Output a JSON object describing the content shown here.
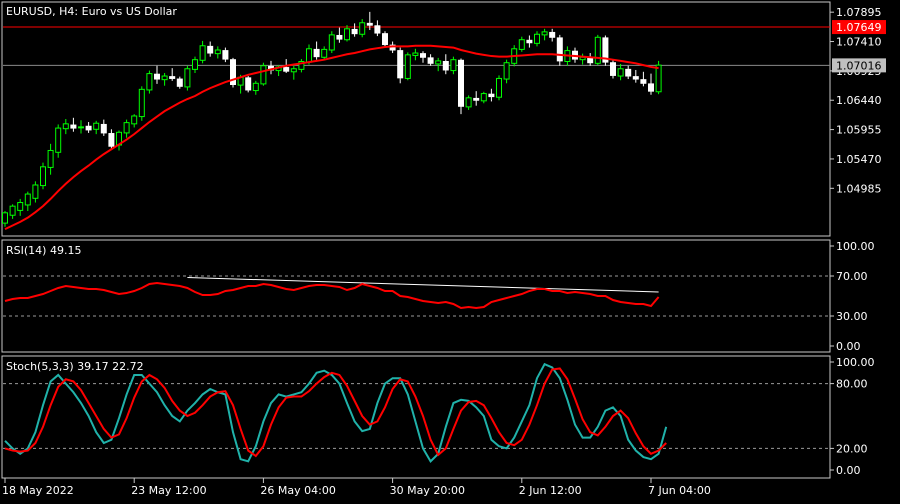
{
  "theme": {
    "background": "#000000",
    "frame": "#c8c8c8",
    "grid_dash": "#9a9a9a",
    "bull_candle": "#00ff00",
    "bear_candle": "#ffffff",
    "ma_line": "#ff0000",
    "rsi_line": "#ff0000",
    "trend_line": "#ffffff",
    "stoch_main": "#20b2aa",
    "stoch_signal": "#ff0000",
    "red_level_tag": "#ff0000",
    "price_tag": "#c0c0c0"
  },
  "chart_data": [
    {
      "type": "candlestick",
      "title": "EURUSD, H4:  Euro vs US Dollar",
      "ylim": [
        1.0423,
        1.0803
      ],
      "y_ticks": [
        "1.07895",
        "1.07410",
        "1.06925",
        "1.06440",
        "1.05955",
        "1.05470",
        "1.04985"
      ],
      "levels": [
        {
          "name": "red-level",
          "value": 1.07649,
          "label": "1.07649"
        },
        {
          "name": "current-price",
          "value": 1.07016,
          "label": "1.07016"
        }
      ],
      "candles": [
        [
          1.0441,
          1.0461,
          1.0435,
          1.0458
        ],
        [
          1.0454,
          1.0472,
          1.0448,
          1.0469
        ],
        [
          1.0462,
          1.0481,
          1.0453,
          1.0475
        ],
        [
          1.0471,
          1.0493,
          1.0461,
          1.0489
        ],
        [
          1.0482,
          1.051,
          1.0475,
          1.0504
        ],
        [
          1.0503,
          1.0541,
          1.0497,
          1.0534
        ],
        [
          1.0533,
          1.0572,
          1.0521,
          1.0561
        ],
        [
          1.0558,
          1.0604,
          1.0549,
          1.0598
        ],
        [
          1.0597,
          1.0613,
          1.0588,
          1.0605
        ],
        [
          1.0603,
          1.0615,
          1.0592,
          1.0598
        ],
        [
          1.0599,
          1.0611,
          1.0589,
          1.06
        ],
        [
          1.0601,
          1.0608,
          1.059,
          1.0595
        ],
        [
          1.0596,
          1.061,
          1.0588,
          1.0606
        ],
        [
          1.0604,
          1.0612,
          1.0585,
          1.059
        ],
        [
          1.0589,
          1.0596,
          1.0563,
          1.0568
        ],
        [
          1.057,
          1.0594,
          1.0561,
          1.0591
        ],
        [
          1.059,
          1.0612,
          1.0582,
          1.0607
        ],
        [
          1.0605,
          1.0621,
          1.0599,
          1.0618
        ],
        [
          1.0617,
          1.0667,
          1.061,
          1.0662
        ],
        [
          1.0661,
          1.0693,
          1.0655,
          1.0688
        ],
        [
          1.0687,
          1.0701,
          1.0671,
          1.0679
        ],
        [
          1.0678,
          1.0689,
          1.0668,
          1.0684
        ],
        [
          1.0683,
          1.0697,
          1.0676,
          1.068
        ],
        [
          1.0679,
          1.0683,
          1.0663,
          1.0667
        ],
        [
          1.0666,
          1.0701,
          1.066,
          1.0696
        ],
        [
          1.0695,
          1.0716,
          1.0689,
          1.0711
        ],
        [
          1.071,
          1.0742,
          1.0705,
          1.0734
        ],
        [
          1.0733,
          1.0741,
          1.0716,
          1.0722
        ],
        [
          1.0721,
          1.0733,
          1.0713,
          1.0727
        ],
        [
          1.0726,
          1.0731,
          1.0707,
          1.0712
        ],
        [
          1.0711,
          1.0714,
          1.0665,
          1.067
        ],
        [
          1.0669,
          1.0686,
          1.0655,
          1.0682
        ],
        [
          1.0681,
          1.0684,
          1.0657,
          1.0661
        ],
        [
          1.066,
          1.0676,
          1.0653,
          1.0672
        ],
        [
          1.0671,
          1.0706,
          1.0668,
          1.0701
        ],
        [
          1.07,
          1.0709,
          1.0687,
          1.0694
        ],
        [
          1.0693,
          1.0702,
          1.0684,
          1.0699
        ],
        [
          1.0698,
          1.0712,
          1.0689,
          1.0692
        ],
        [
          1.0691,
          1.0701,
          1.0678,
          1.0696
        ],
        [
          1.0695,
          1.0712,
          1.069,
          1.0708
        ],
        [
          1.0707,
          1.0736,
          1.0703,
          1.0729
        ],
        [
          1.0728,
          1.0741,
          1.0711,
          1.0716
        ],
        [
          1.0715,
          1.0733,
          1.071,
          1.0728
        ],
        [
          1.0727,
          1.0758,
          1.0722,
          1.0752
        ],
        [
          1.0751,
          1.0764,
          1.0739,
          1.0745
        ],
        [
          1.0744,
          1.0768,
          1.0741,
          1.0762
        ],
        [
          1.0761,
          1.0771,
          1.0749,
          1.0754
        ],
        [
          1.0753,
          1.0778,
          1.0748,
          1.0772
        ],
        [
          1.0771,
          1.079,
          1.076,
          1.0768
        ],
        [
          1.0767,
          1.0776,
          1.075,
          1.0755
        ],
        [
          1.0754,
          1.0758,
          1.0731,
          1.0736
        ],
        [
          1.0735,
          1.0741,
          1.0722,
          1.0727
        ],
        [
          1.0726,
          1.0731,
          1.0672,
          1.0681
        ],
        [
          1.068,
          1.0723,
          1.0677,
          1.0719
        ],
        [
          1.0718,
          1.0729,
          1.071,
          1.0722
        ],
        [
          1.0721,
          1.0725,
          1.0706,
          1.0715
        ],
        [
          1.0714,
          1.072,
          1.0701,
          1.0705
        ],
        [
          1.0704,
          1.0714,
          1.0692,
          1.0709
        ],
        [
          1.0708,
          1.072,
          1.0687,
          1.0694
        ],
        [
          1.0693,
          1.0716,
          1.0687,
          1.0711
        ],
        [
          1.071,
          1.0713,
          1.0621,
          1.0634
        ],
        [
          1.0633,
          1.0652,
          1.0628,
          1.0648
        ],
        [
          1.0647,
          1.0659,
          1.0635,
          1.0644
        ],
        [
          1.0643,
          1.0658,
          1.0639,
          1.0655
        ],
        [
          1.0654,
          1.0663,
          1.0642,
          1.065
        ],
        [
          1.0649,
          1.0685,
          1.0644,
          1.068
        ],
        [
          1.0679,
          1.0711,
          1.0672,
          1.0706
        ],
        [
          1.0705,
          1.0735,
          1.07,
          1.0729
        ],
        [
          1.0728,
          1.0749,
          1.0724,
          1.0744
        ],
        [
          1.0743,
          1.0751,
          1.0731,
          1.0739
        ],
        [
          1.0738,
          1.0758,
          1.0733,
          1.0753
        ],
        [
          1.0752,
          1.0762,
          1.0743,
          1.0757
        ],
        [
          1.0756,
          1.0762,
          1.0741,
          1.0748
        ],
        [
          1.0747,
          1.0752,
          1.0701,
          1.0709
        ],
        [
          1.0708,
          1.0733,
          1.0701,
          1.0726
        ],
        [
          1.0725,
          1.0731,
          1.0706,
          1.0712
        ],
        [
          1.0711,
          1.0721,
          1.0703,
          1.0715
        ],
        [
          1.0714,
          1.0722,
          1.0701,
          1.0706
        ],
        [
          1.0705,
          1.0752,
          1.0702,
          1.0748
        ],
        [
          1.0747,
          1.0751,
          1.0701,
          1.0707
        ],
        [
          1.0706,
          1.0711,
          1.068,
          1.0685
        ],
        [
          1.0684,
          1.0704,
          1.0677,
          1.0696
        ],
        [
          1.0695,
          1.0701,
          1.0679,
          1.0684
        ],
        [
          1.0683,
          1.0694,
          1.0673,
          1.0679
        ],
        [
          1.0678,
          1.0691,
          1.0667,
          1.0672
        ],
        [
          1.0671,
          1.0688,
          1.0653,
          1.0659
        ],
        [
          1.0658,
          1.0709,
          1.0654,
          1.0702
        ]
      ],
      "moving_average": [
        1.0431,
        1.0437,
        1.0443,
        1.045,
        1.0459,
        1.0469,
        1.0481,
        1.0494,
        1.0506,
        1.0517,
        1.0527,
        1.0536,
        1.0546,
        1.0555,
        1.0563,
        1.0571,
        1.0579,
        1.0588,
        1.0598,
        1.0608,
        1.0617,
        1.0626,
        1.0633,
        1.064,
        1.0646,
        1.0651,
        1.0658,
        1.0664,
        1.0669,
        1.0674,
        1.0678,
        1.0682,
        1.0686,
        1.0689,
        1.0692,
        1.0695,
        1.0698,
        1.0701,
        1.0703,
        1.0705,
        1.0707,
        1.0709,
        1.0711,
        1.0714,
        1.0717,
        1.072,
        1.0722,
        1.0725,
        1.0728,
        1.073,
        1.0732,
        1.0733,
        1.0733,
        1.0733,
        1.0734,
        1.0734,
        1.0734,
        1.0733,
        1.0732,
        1.0731,
        1.0727,
        1.0724,
        1.0721,
        1.0719,
        1.0717,
        1.0716,
        1.0716,
        1.0717,
        1.0718,
        1.0719,
        1.072,
        1.072,
        1.072,
        1.0719,
        1.0718,
        1.0717,
        1.0716,
        1.0715,
        1.0714,
        1.0713,
        1.0711,
        1.0709,
        1.0707,
        1.0705,
        1.0702,
        1.0699,
        1.0697
      ],
      "x_labels": [
        {
          "index": 0,
          "label": "18 May 2022"
        },
        {
          "index": 17,
          "label": "23 May 12:00"
        },
        {
          "index": 34,
          "label": "26 May 04:00"
        },
        {
          "index": 51,
          "label": "30 May 20:00"
        },
        {
          "index": 68,
          "label": "2 Jun 12:00"
        },
        {
          "index": 85,
          "label": "7 Jun 04:00"
        }
      ]
    },
    {
      "type": "line",
      "title": "RSI(14) 49.15",
      "ylim": [
        0,
        100
      ],
      "y_ticks": [
        "100.00",
        "70.00",
        "30.00",
        "0.00"
      ],
      "levels": [
        70,
        30
      ],
      "trend_line": {
        "from_index": 24,
        "from_value": 68.5,
        "to_index": 86,
        "to_value": 54.0
      },
      "values": [
        45,
        47,
        48,
        48,
        50,
        52,
        55,
        58,
        60,
        59,
        58,
        57,
        57,
        56,
        54,
        52,
        53,
        55,
        58,
        62,
        63,
        62,
        61,
        60,
        58,
        54,
        51,
        51,
        52,
        55,
        56,
        58,
        60,
        60,
        62,
        61,
        59,
        57,
        56,
        58,
        60,
        61,
        61,
        60,
        59,
        56,
        58,
        62,
        60,
        58,
        55,
        55,
        50,
        49,
        47,
        45,
        44,
        43,
        44,
        42,
        38,
        39,
        38,
        39,
        44,
        46,
        48,
        50,
        52,
        55,
        57,
        57,
        55,
        55,
        53,
        54,
        53,
        52,
        50,
        50,
        46,
        44,
        43,
        42,
        42,
        40,
        49
      ]
    },
    {
      "type": "line",
      "title": "Stoch(5,3,3) 39.17 22.72",
      "ylim": [
        0,
        100
      ],
      "y_ticks": [
        "100.00",
        "80.00",
        "20.00",
        "0.00"
      ],
      "levels": [
        80,
        20
      ],
      "series": [
        {
          "name": "main",
          "values": [
            27,
            20,
            15,
            20,
            35,
            60,
            82,
            88,
            80,
            72,
            62,
            50,
            35,
            25,
            28,
            48,
            70,
            88,
            88,
            80,
            72,
            60,
            50,
            45,
            55,
            62,
            70,
            75,
            72,
            70,
            35,
            10,
            8,
            22,
            45,
            62,
            70,
            68,
            70,
            72,
            80,
            90,
            92,
            88,
            80,
            62,
            45,
            36,
            38,
            62,
            80,
            85,
            85,
            70,
            45,
            20,
            8,
            15,
            40,
            62,
            65,
            64,
            58,
            50,
            28,
            22,
            20,
            30,
            45,
            60,
            85,
            98,
            95,
            85,
            65,
            42,
            30,
            30,
            40,
            55,
            58,
            50,
            28,
            18,
            12,
            10,
            15,
            40
          ]
        },
        {
          "name": "signal",
          "values": [
            20,
            18,
            17,
            18,
            25,
            40,
            60,
            77,
            84,
            82,
            74,
            62,
            50,
            38,
            30,
            33,
            48,
            67,
            82,
            88,
            84,
            76,
            64,
            55,
            50,
            53,
            60,
            68,
            72,
            73,
            60,
            38,
            18,
            13,
            22,
            42,
            58,
            67,
            68,
            68,
            73,
            80,
            86,
            90,
            88,
            78,
            64,
            50,
            42,
            45,
            58,
            75,
            84,
            82,
            68,
            50,
            28,
            14,
            20,
            38,
            55,
            63,
            64,
            60,
            48,
            35,
            25,
            23,
            28,
            42,
            60,
            80,
            93,
            94,
            84,
            66,
            47,
            35,
            32,
            40,
            50,
            55,
            48,
            34,
            22,
            15,
            18,
            25
          ]
        }
      ]
    }
  ]
}
